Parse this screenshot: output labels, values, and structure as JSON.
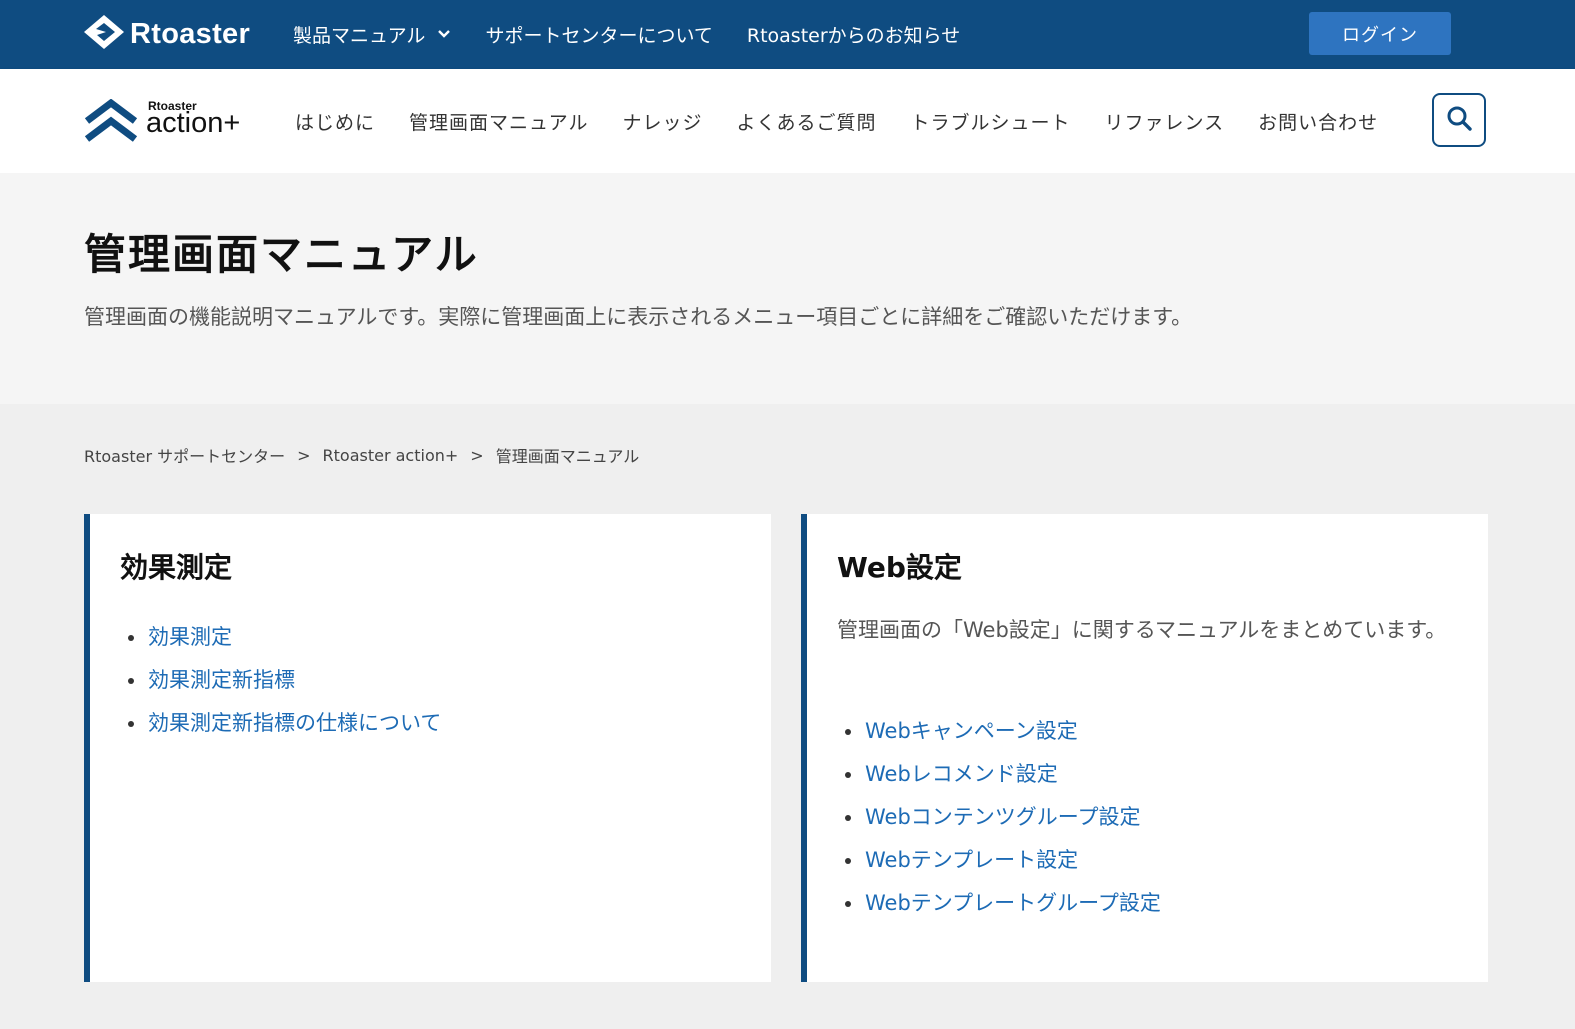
{
  "topbar": {
    "brand": "Rtoaster",
    "nav": [
      {
        "label": "製品マニュアル",
        "has_dropdown": true
      },
      {
        "label": "サポートセンターについて",
        "has_dropdown": false
      },
      {
        "label": "Rtoasterからのお知らせ",
        "has_dropdown": false
      }
    ],
    "login_label": "ログイン"
  },
  "product": {
    "logo_small": "Rtoaster",
    "logo_big": "action+"
  },
  "mainnav": [
    "はじめに",
    "管理画面マニュアル",
    "ナレッジ",
    "よくあるご質問",
    "トラブルシュート",
    "リファレンス",
    "お問い合わせ"
  ],
  "hero": {
    "title": "管理画面マニュアル",
    "description": "管理画面の機能説明マニュアルです。実際に管理画面上に表示されるメニュー項目ごとに詳細をご確認いただけます。"
  },
  "breadcrumb": [
    "Rtoaster サポートセンター",
    "Rtoaster action+",
    "管理画面マニュアル"
  ],
  "breadcrumb_sep": ">",
  "cards": [
    {
      "title": "効果測定",
      "description": "",
      "links": [
        "効果測定",
        "効果測定新指標",
        "効果測定新指標の仕様について"
      ]
    },
    {
      "title": "Web設定",
      "description": "管理画面の「Web設定」に関するマニュアルをまとめています。",
      "links": [
        "Webキャンペーン設定",
        "Webレコメンド設定",
        "Webコンテンツグループ設定",
        "Webテンプレート設定",
        "Webテンプレートグループ設定"
      ]
    }
  ],
  "colors": {
    "primary": "#0f4c81",
    "login_button": "#2e74c0",
    "link": "#1d6bb5"
  },
  "icons": {
    "search": "search-icon",
    "brand": "rtoaster-logo-icon",
    "product": "action-plus-logo-icon"
  }
}
